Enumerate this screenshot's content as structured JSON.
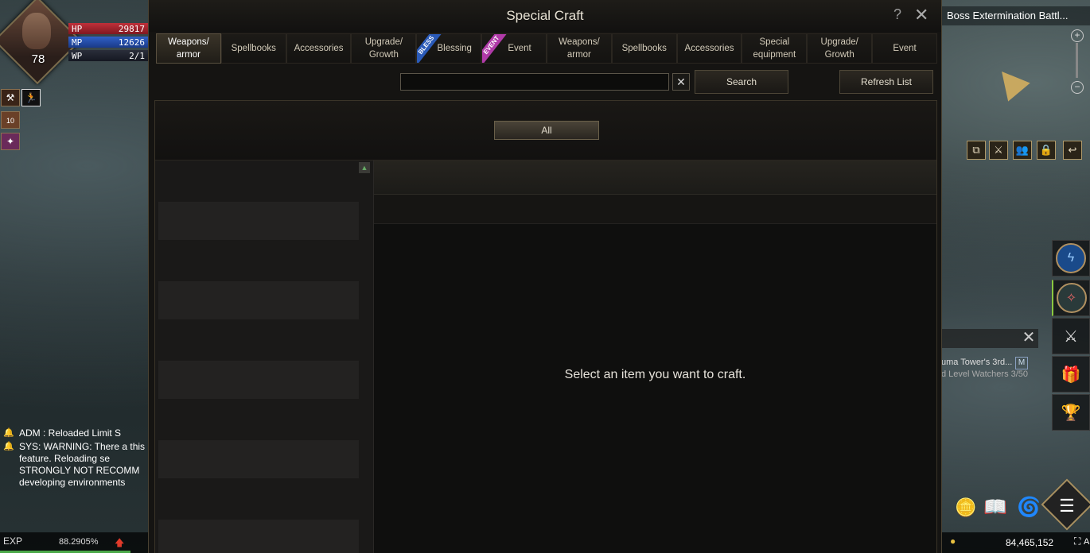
{
  "player": {
    "level": "78",
    "hp_label": "HP",
    "hp_value": "29817",
    "mp_label": "MP",
    "mp_value": "12626",
    "wp_label": "WP",
    "wp_value": "2/1",
    "buff_count": "10"
  },
  "chat": {
    "lines": [
      "ADM : Reloaded Limit S",
      "SYS: WARNING: There a this feature. Reloading se STRONGLY NOT RECOMM developing environments"
    ]
  },
  "exp": {
    "label": "EXP",
    "percent": "88.2905%",
    "fill": 0.88
  },
  "quest_tab": {
    "title": "Boss Extermination Battl..."
  },
  "quest_tracker": {
    "title": "uma Tower's 3rd...",
    "badge": "M",
    "objective": "d Level Watchers 3/50"
  },
  "money": {
    "amount": "84,465,152",
    "suffix": "A"
  },
  "window": {
    "title": "Special Craft",
    "help": "?",
    "close": "✕"
  },
  "tabs": [
    {
      "label": "Weapons/ armor",
      "active": true,
      "ribbon": ""
    },
    {
      "label": "Spellbooks",
      "ribbon": ""
    },
    {
      "label": "Accessories",
      "ribbon": ""
    },
    {
      "label": "Upgrade/ Growth",
      "ribbon": ""
    },
    {
      "label": "Blessing",
      "ribbon": "BLESS"
    },
    {
      "label": "Event",
      "ribbon": "EVENT"
    },
    {
      "label": "Weapons/ armor",
      "ribbon": ""
    },
    {
      "label": "Spellbooks",
      "ribbon": ""
    },
    {
      "label": "Accessories",
      "ribbon": ""
    },
    {
      "label": "Special equipment",
      "ribbon": ""
    },
    {
      "label": "Upgrade/ Growth",
      "ribbon": ""
    },
    {
      "label": "Event",
      "ribbon": ""
    }
  ],
  "search": {
    "value": "",
    "placeholder": "",
    "clear": "✕",
    "button": "Search"
  },
  "refresh_button": "Refresh List",
  "filter": {
    "all_label": "All"
  },
  "detail": {
    "hint": "Select an item you want to craft."
  },
  "colors": {
    "hp": "#c0303a",
    "mp": "#3060c8",
    "accent": "#b09a6a",
    "bless": "#2a5ab8",
    "event": "#b03aa8"
  }
}
